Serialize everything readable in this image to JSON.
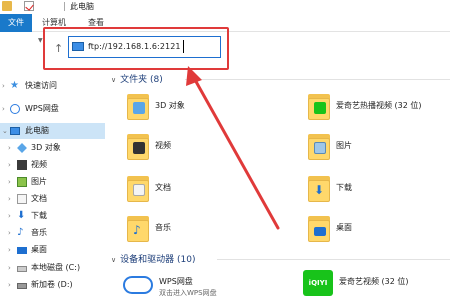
{
  "window": {
    "title": "此电脑"
  },
  "ribbon": {
    "file_tab": "文件",
    "tabs": [
      "计算机",
      "查看"
    ]
  },
  "address_bar": {
    "value": "ftp://192.168.1.6:2121"
  },
  "sidebar": {
    "items": [
      {
        "label": "快速访问",
        "icon": "star-icon"
      },
      {
        "label": "WPS网盘",
        "icon": "cloud-icon"
      },
      {
        "label": "此电脑",
        "icon": "pc-icon",
        "selected": true
      },
      {
        "label": "3D 对象",
        "icon": "cube-icon"
      },
      {
        "label": "视频",
        "icon": "video-icon"
      },
      {
        "label": "图片",
        "icon": "picture-icon"
      },
      {
        "label": "文档",
        "icon": "document-icon"
      },
      {
        "label": "下载",
        "icon": "download-icon"
      },
      {
        "label": "音乐",
        "icon": "music-icon"
      },
      {
        "label": "桌面",
        "icon": "desktop-icon"
      },
      {
        "label": "本地磁盘 (C:)",
        "icon": "drive-icon"
      },
      {
        "label": "新加卷 (D:)",
        "icon": "drive-icon"
      }
    ]
  },
  "main": {
    "folders_header": "文件夹 (8)",
    "folders": [
      {
        "label": "3D 对象",
        "icon": "cube-folder-icon"
      },
      {
        "label": "爱奇艺热播视频 (32 位)",
        "icon": "iqiyi-folder-icon"
      },
      {
        "label": "视频",
        "icon": "video-folder-icon"
      },
      {
        "label": "图片",
        "icon": "picture-folder-icon"
      },
      {
        "label": "文档",
        "icon": "document-folder-icon"
      },
      {
        "label": "下载",
        "icon": "download-folder-icon"
      },
      {
        "label": "音乐",
        "icon": "music-folder-icon"
      },
      {
        "label": "桌面",
        "icon": "desktop-folder-icon"
      }
    ],
    "devices_header": "设备和驱动器 (10)",
    "devices": [
      {
        "label": "WPS网盘",
        "sub": "双击进入WPS网盘",
        "icon": "wps-cloud-icon"
      },
      {
        "label": "爱奇艺视频 (32 位)",
        "icon": "iqiyi-icon"
      }
    ]
  },
  "colors": {
    "accent": "#1979ca",
    "annotation_red": "#e03a3a",
    "selected_bg": "#cce4f7"
  }
}
